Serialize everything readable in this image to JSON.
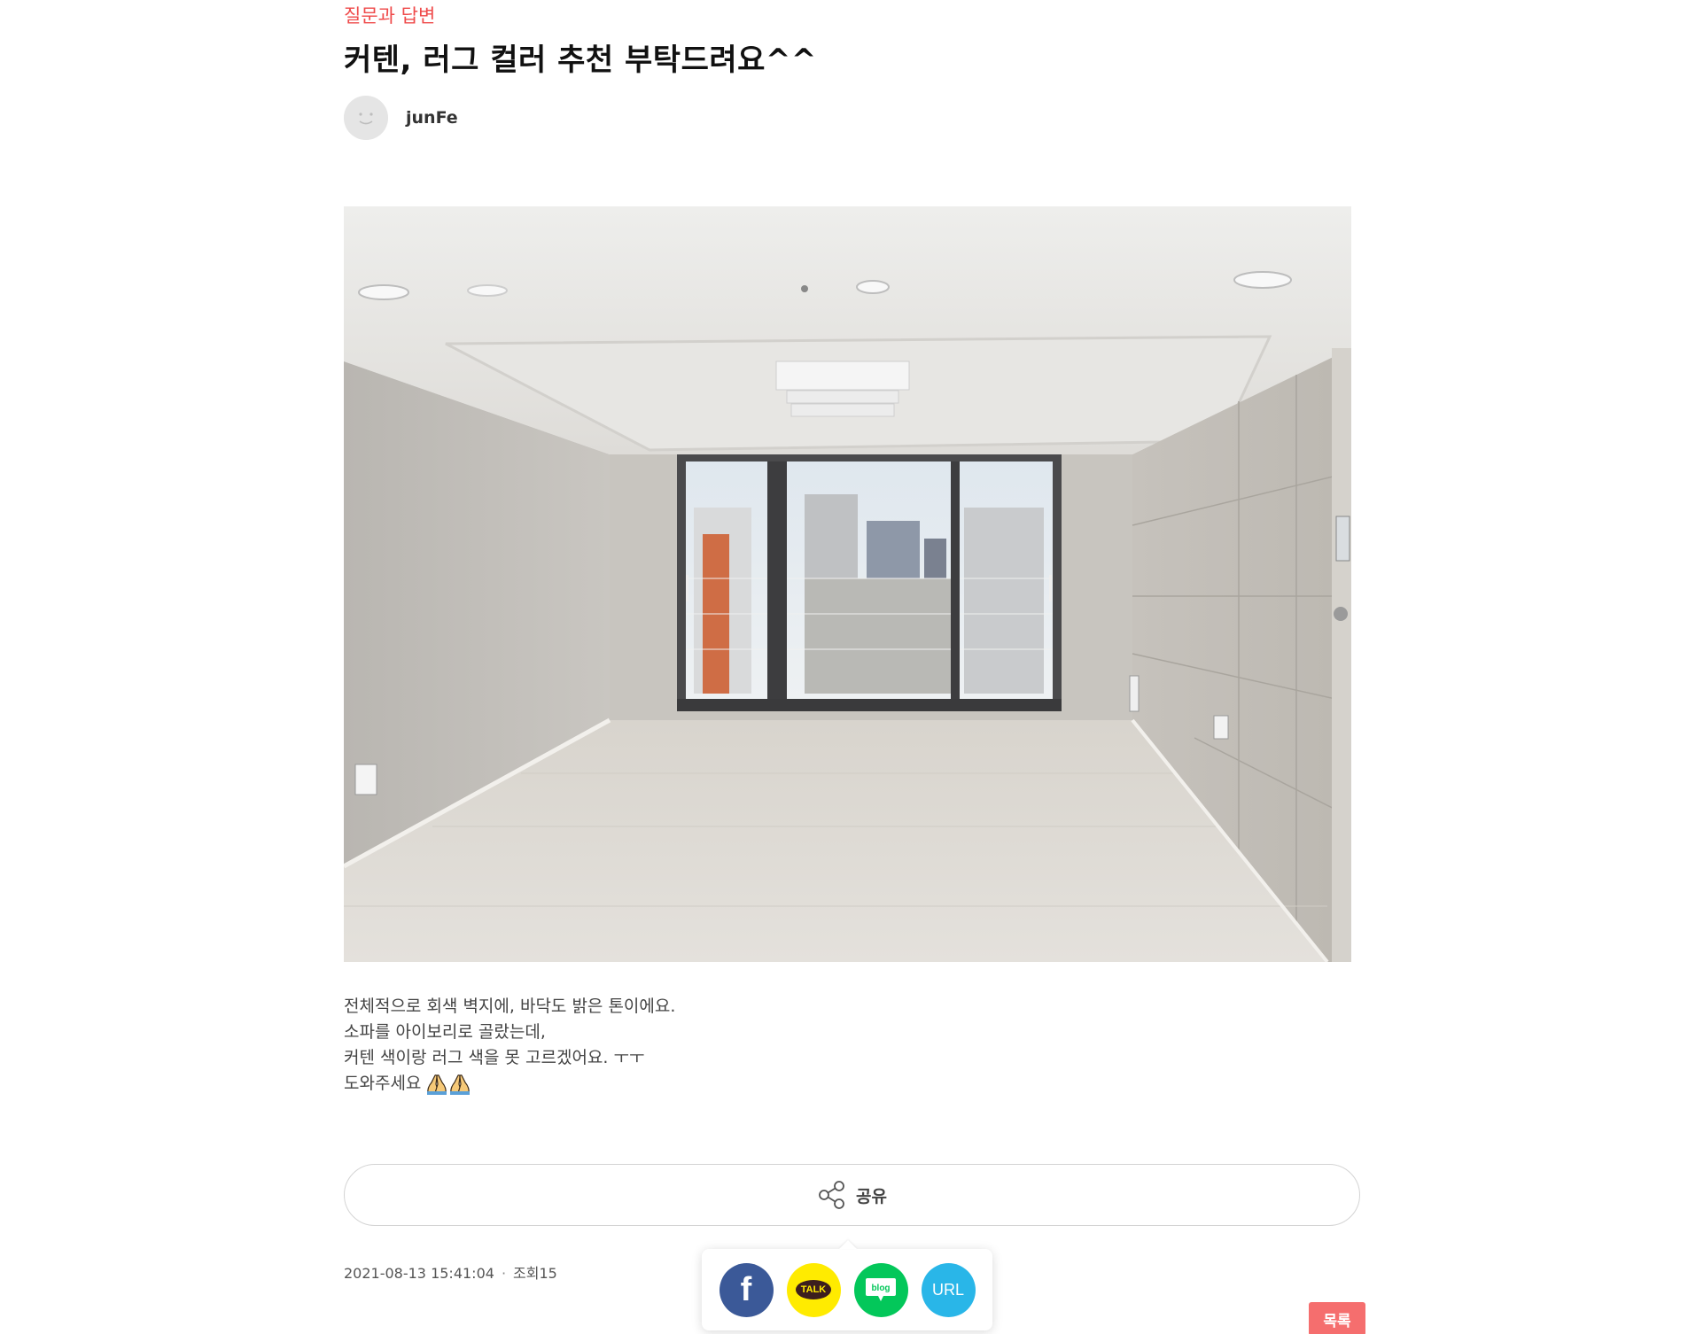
{
  "category": "질문과 답변",
  "title": "커텐, 러그 컬러 추천 부탁드려요^^",
  "author": {
    "name": "junFe"
  },
  "content": {
    "lines": [
      "전체적으로 회색 벽지에, 바닥도 밝은 톤이에요.",
      "소파를 아이보리로 골랐는데,",
      "커텐 색이랑 러그 색을 못 고르겠어요. ㅜㅜ",
      "도와주세요"
    ],
    "emoji": "pray-hands-icon x2"
  },
  "share": {
    "label": "공유"
  },
  "meta": {
    "datetime": "2021-08-13 15:41:04",
    "views": "조회15",
    "separator": "·"
  },
  "share_popup": {
    "facebook": "f",
    "kakao": "TALK",
    "blog": "blog",
    "url": "URL"
  },
  "list_button": "목록",
  "colors": {
    "accent": "#ef4a4a",
    "list_button": "#f56e6e",
    "facebook": "#3b5998",
    "kakao": "#ffeb00",
    "blog": "#03c75a",
    "url": "#29b6e8"
  }
}
